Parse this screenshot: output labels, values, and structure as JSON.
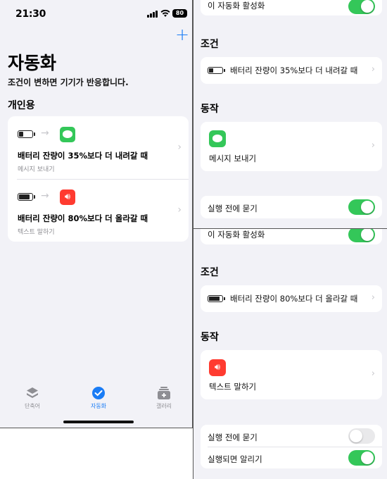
{
  "left": {
    "status": {
      "time": "21:30",
      "battery": "80"
    },
    "title": "자동화",
    "subtitle": "조건이 변하면 기기가 반응합니다.",
    "section": "개인용",
    "automations": [
      {
        "title": "배터리 잔량이 35%보다 더 내려갈 때",
        "subtitle": "메시지 보내기",
        "battery_level": 0.35,
        "app_icon": "messages-icon"
      },
      {
        "title": "배터리 잔량이 80%보다 더 올라갈 때",
        "subtitle": "텍스트 말하기",
        "battery_level": 0.8,
        "app_icon": "speak-text-icon"
      }
    ],
    "tabs": [
      {
        "label": "단축어",
        "icon": "stack-icon",
        "active": false
      },
      {
        "label": "자동화",
        "icon": "check-clock-icon",
        "active": true
      },
      {
        "label": "갤러리",
        "icon": "gallery-add-icon",
        "active": false
      }
    ]
  },
  "detail_top": {
    "enable_label": "이 자동화 활성화",
    "enable_on": true,
    "condition_header": "조건",
    "condition_text": "배터리 잔량이 35%보다 더 내려갈 때",
    "battery_level": 0.35,
    "action_header": "동작",
    "action_label": "메시지 보내기",
    "ask_label": "실행 전에 묻기",
    "ask_on": true
  },
  "detail_bottom": {
    "enable_label": "이 자동화 활성화",
    "enable_on": true,
    "condition_header": "조건",
    "condition_text": "배터리 잔량이 80%보다 더 올라갈 때",
    "battery_level": 0.8,
    "action_header": "동작",
    "action_label": "텍스트 말하기",
    "ask_label": "실행 전에 묻기",
    "ask_on": false,
    "notify_label": "실행되면 알리기",
    "notify_on": true
  },
  "colors": {
    "accent": "#1a7cf5",
    "toggle_on": "#34c759",
    "messages": "#34c759",
    "speak": "#ff3b30"
  }
}
